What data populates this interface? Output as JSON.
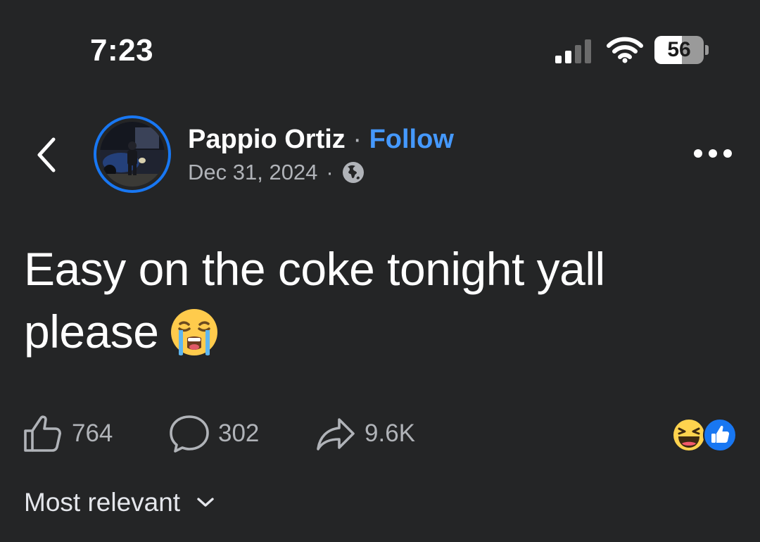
{
  "status_bar": {
    "time": "7:23",
    "battery_percent": "56",
    "battery_level": 0.56,
    "signal_bars_active": 2,
    "signal_bars_total": 4,
    "icons": [
      "signal-icon",
      "wifi-icon",
      "battery-icon"
    ]
  },
  "header": {
    "back_icon": "chevron-left-icon",
    "author_name": "Pappio Ortiz",
    "separator": "·",
    "follow_label": "Follow",
    "date": "Dec 31, 2024",
    "privacy_icon": "globe-icon",
    "more_icon": "more-horizontal-icon"
  },
  "post": {
    "text": "Easy on the coke tonight yall please",
    "emoji": "loudly-crying-face"
  },
  "actions": {
    "like_count": "764",
    "comment_count": "302",
    "share_count": "9.6K",
    "reactions": [
      "haha",
      "like"
    ]
  },
  "comments": {
    "sort_label": "Most relevant"
  },
  "colors": {
    "background": "#242526",
    "accent": "#1877f2",
    "follow": "#4599ff",
    "secondary_text": "#b0b3b8"
  }
}
